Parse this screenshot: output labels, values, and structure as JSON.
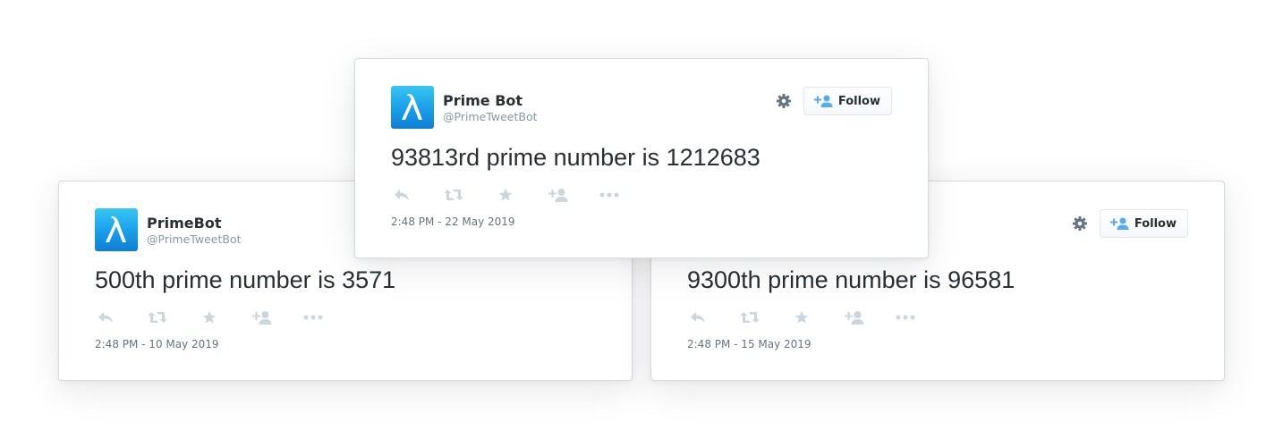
{
  "tweets": [
    {
      "display_name": "PrimeBot",
      "handle": "@PrimeTweetBot",
      "text": "500th prime number is 3571",
      "timestamp": "2:48 PM - 10 May 2019"
    },
    {
      "follow_label": "Follow",
      "text": "9300th prime number is 96581",
      "timestamp": "2:48 PM - 15 May 2019"
    },
    {
      "display_name": "Prime Bot",
      "handle": "@PrimeTweetBot",
      "follow_label": "Follow",
      "text": "93813rd prime number is 1212683",
      "timestamp": "2:48 PM - 22 May 2019"
    }
  ],
  "icons": {
    "avatar": "lambda-logo-icon",
    "settings": "gear-icon",
    "follow": "add-user-icon",
    "reply": "reply-icon",
    "retweet": "retweet-icon",
    "favorite": "star-icon",
    "follow_action": "add-user-icon",
    "more": "more-dots-icon"
  },
  "colors": {
    "accent": "#55acee",
    "avatar_top": "#36c6f4",
    "avatar_bottom": "#0d7fd6",
    "text": "#292f33",
    "muted": "#8899a6",
    "icon": "#ccd6dd"
  }
}
